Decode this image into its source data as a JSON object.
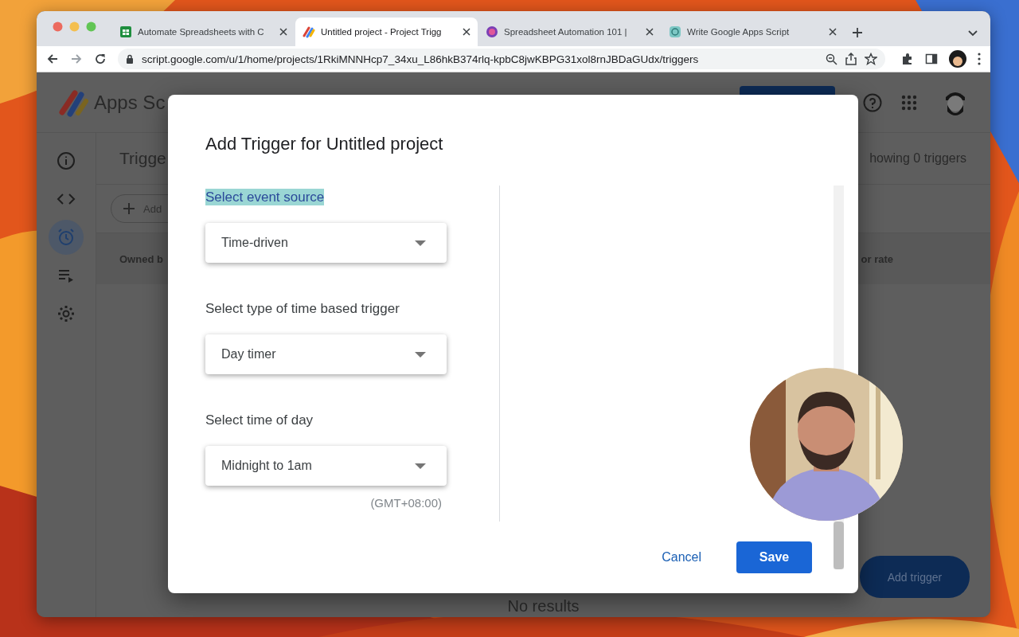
{
  "browser": {
    "tabs": [
      {
        "title": "Automate Spreadsheets with C",
        "kind": "sheet",
        "selected": false
      },
      {
        "title": "Untitled project - Project Trigg",
        "kind": "script",
        "selected": true
      },
      {
        "title": "Spreadsheet Automation 101 |",
        "kind": "course",
        "selected": false
      },
      {
        "title": "Write Google Apps Script",
        "kind": "chat",
        "selected": false
      }
    ],
    "url": "script.google.com/u/1/home/projects/1RkiMNNHcp7_34xu_L86hkB374rlq-kpbC8jwKBPG31xol8rnJBDaGUdx/triggers"
  },
  "page": {
    "app_name": "Apps Sc",
    "sidebar": [
      {
        "kind": "info",
        "selected": false
      },
      {
        "kind": "code",
        "selected": false
      },
      {
        "kind": "clock",
        "selected": true
      },
      {
        "kind": "list",
        "selected": false
      },
      {
        "kind": "gear",
        "selected": false
      }
    ],
    "title": "Trigge",
    "trigger_count": "howing 0 triggers",
    "add_button": "Add",
    "columns": [
      "Owned b",
      "or rate"
    ],
    "empty_message": "No results",
    "fab": "Add trigger"
  },
  "dialog": {
    "title": "Add Trigger for Untitled project",
    "fields": [
      {
        "label": "Select event source",
        "highlighted": true,
        "value": "Time-driven"
      },
      {
        "label": "Select type of time based trigger",
        "highlighted": false,
        "value": "Day timer"
      },
      {
        "label": "Select time of day",
        "highlighted": false,
        "value": "Midnight to 1am",
        "note": "(GMT+08:00)"
      }
    ],
    "cancel": "Cancel",
    "save": "Save"
  }
}
